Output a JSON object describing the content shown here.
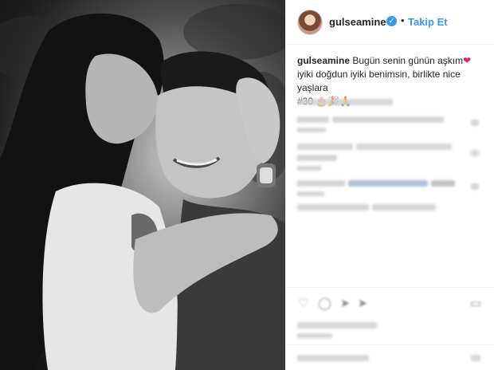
{
  "post": {
    "username": "gulseamine",
    "verified_symbol": "✓",
    "separator": "•",
    "follow_label": "Takip Et",
    "caption_user": "gulseamine",
    "caption_text_1": " Bugün senin günün aşkım",
    "caption_heart": "❤",
    "caption_text_2": "iyiki doğdun iyiki benimsin, birlikte nice yaşlara",
    "caption_hashtag": "#30",
    "caption_emojis": "🎂🎉🙏"
  },
  "icons": {
    "heart": "♡",
    "comment": "◯",
    "share": "➤",
    "save": "▭"
  },
  "colors": {
    "accent": "#3897f0",
    "verified": "#3897f0",
    "heart": "#e0245e",
    "hashtag": "#003569"
  }
}
